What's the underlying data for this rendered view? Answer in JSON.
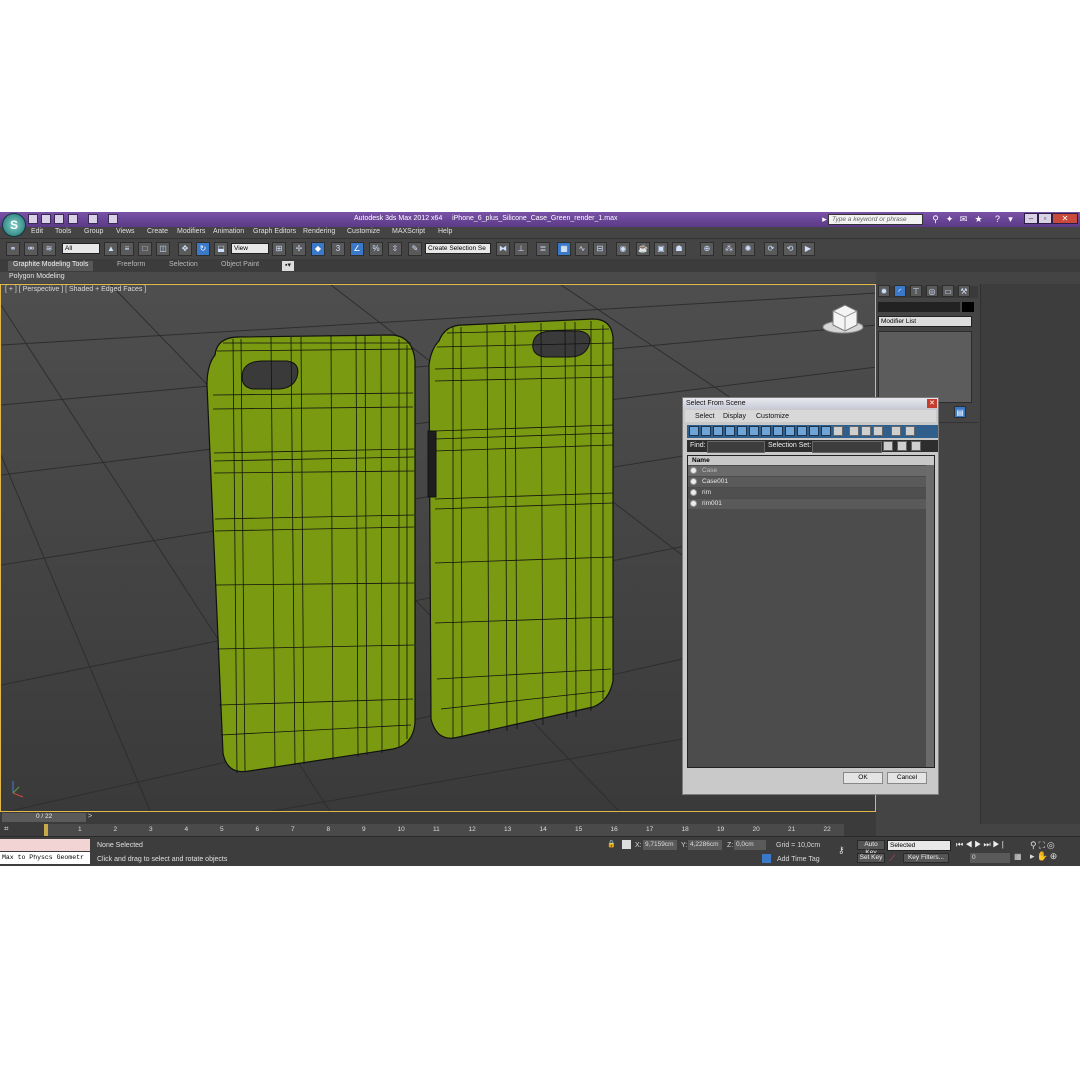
{
  "window": {
    "title": "Autodesk 3ds Max  2012 x64",
    "filename": "iPhone_6_plus_Silicone_Case_Green_render_1.max",
    "search_placeholder": "Type a keyword or phrase"
  },
  "menu": [
    "Edit",
    "Tools",
    "Group",
    "Views",
    "Create",
    "Modifiers",
    "Animation",
    "Graph Editors",
    "Rendering",
    "Customize",
    "MAXScript",
    "Help"
  ],
  "toolbar": {
    "filter_value": "All",
    "coord_value": "View",
    "selection_set_value": "Create Selection Se"
  },
  "ribbon": {
    "tabs": [
      "Graphite Modeling Tools",
      "Freeform",
      "Selection",
      "Object Paint"
    ],
    "sub_label": "Polygon Modeling"
  },
  "viewport": {
    "label": "[ + ] [ Perspective ] [ Shaded + Edged Faces ]",
    "mesh_color": "#7a9a12"
  },
  "command_panel": {
    "modifier_list": "Modifier List"
  },
  "dialog": {
    "title": "Select From Scene",
    "menu": [
      "Select",
      "Display",
      "Customize"
    ],
    "find_label": "Find:",
    "selection_set_label": "Selection Set:",
    "column_name": "Name",
    "rows": [
      "Case",
      "Case001",
      "rim",
      "rim001"
    ],
    "ok_label": "OK",
    "cancel_label": "Cancel"
  },
  "timeline": {
    "frame_counter": "0 / 22",
    "ticks": [
      "1",
      "2",
      "3",
      "4",
      "5",
      "6",
      "7",
      "8",
      "9",
      "10",
      "11",
      "12",
      "13",
      "14",
      "15",
      "16",
      "17",
      "18",
      "19",
      "20",
      "21",
      "22"
    ]
  },
  "status": {
    "maxscript_text": "Max to Physcs Geometr",
    "selection_text": "None Selected",
    "prompt_text": "Click and drag to select and rotate objects",
    "x_label": "X:",
    "x_value": "9,7159cm",
    "y_label": "Y:",
    "y_value": "4,2286cm",
    "z_label": "Z:",
    "z_value": "0,0cm",
    "grid_text": "Grid = 10,0cm",
    "add_time_tag": "Add Time Tag",
    "auto_key": "Auto Key",
    "set_key": "Set Key",
    "selected_value": "Selected",
    "key_filters": "Key Filters...",
    "frame_value": "0"
  }
}
